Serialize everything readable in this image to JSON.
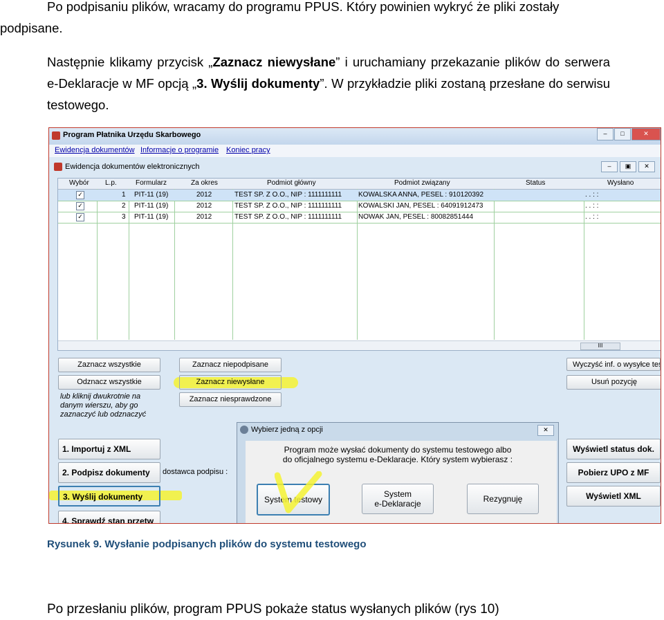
{
  "doc": {
    "p1_line1": "Po podpisaniu plików, wracamy do programu PPUS. Który powinien wykryć że pliki zostały",
    "p1_line2": "podpisane.",
    "p2_a": "Następnie klikamy przycisk „",
    "p2_bold1": "Zaznacz niewysłane",
    "p2_b": "” i uruchamiany przekazanie plików do serwera e-Deklaracje w MF opcją „",
    "p2_bold2": "3. Wyślij dokumenty",
    "p2_c": "”.  W przykładzie pliki zostaną przesłane do serwisu testowego.",
    "caption": "Rysunek 9. Wysłanie podpisanych plików do systemu testowego",
    "bottom": "Po przesłaniu plików, program PPUS pokaże status wysłanych plików (rys 10)"
  },
  "app": {
    "title": "Program Płatnika Urzędu Skarbowego",
    "menu": [
      "Ewidencja dokumentów",
      "Informacje o programie",
      "Koniec pracy"
    ],
    "inner_title": "Ewidencja dokumentów elektronicznych",
    "columns": [
      "Wybór",
      "L.p.",
      "Formularz",
      "Za okres",
      "Podmiot główny",
      "Podmiot związany",
      "Status",
      "Wysłano"
    ],
    "rows": [
      {
        "check": "✓",
        "lp": "1",
        "form": "PIT-11 (19)",
        "period": "2012",
        "main": "TEST SP. Z O.O., NIP : 1111111111",
        "related": "KOWALSKA ANNA, PESEL : 910120392",
        "status": "",
        "sent": ". .    : :"
      },
      {
        "check": "✓",
        "lp": "2",
        "form": "PIT-11 (19)",
        "period": "2012",
        "main": "TEST SP. Z O.O., NIP : 1111111111",
        "related": "KOWALSKI JAN, PESEL : 64091912473",
        "status": "",
        "sent": ". .    : :"
      },
      {
        "check": "✓",
        "lp": "3",
        "form": "PIT-11 (19)",
        "period": "2012",
        "main": "TEST SP. Z O.O., NIP : 1111111111",
        "related": "NOWAK JAN, PESEL : 80082851444",
        "status": "",
        "sent": ". .    : :"
      }
    ],
    "scroll_thumb": "III",
    "buttons": {
      "select_all": "Zaznacz wszystkie",
      "deselect_all": "Odznacz wszystkie",
      "select_unsigned": "Zaznacz niepodpisane",
      "select_unsent": "Zaznacz niewysłane",
      "select_unchecked": "Zaznacz niesprawdzone",
      "clear_sent_info": "Wyczyść inf. o wysyłce tes",
      "delete_item": "Usuń pozycję",
      "import_xml": "1. Importuj z XML",
      "sign_docs": "2. Podpisz dokumenty",
      "send_docs": "3. Wyślij dokumenty",
      "check_status": "4. Sprawdź stan przetw",
      "show_status": "Wyświetl status dok.",
      "get_upo": "Pobierz UPO z MF",
      "show_xml": "Wyświetl XML"
    },
    "note": [
      "lub kliknij dwukrotnie na",
      "danym wierszu, aby go",
      "zaznaczyć lub odznaczyć"
    ],
    "supplier_label": "dostawca podpisu :"
  },
  "dialog": {
    "title": "Wybierz jedną z opcji",
    "message_line1": "Program może wysłać dokumenty do systemu testowego albo",
    "message_line2": "do oficjalnego systemu e-Deklaracje. Który system wybierasz :",
    "btn_test": "System testowy",
    "btn_official_1": "System",
    "btn_official_2": "e-Deklaracje",
    "btn_cancel": "Rezygnuję"
  },
  "colors": {
    "highlight": "#f4f232",
    "caption": "#1f4e79",
    "frame": "#c0392b"
  }
}
